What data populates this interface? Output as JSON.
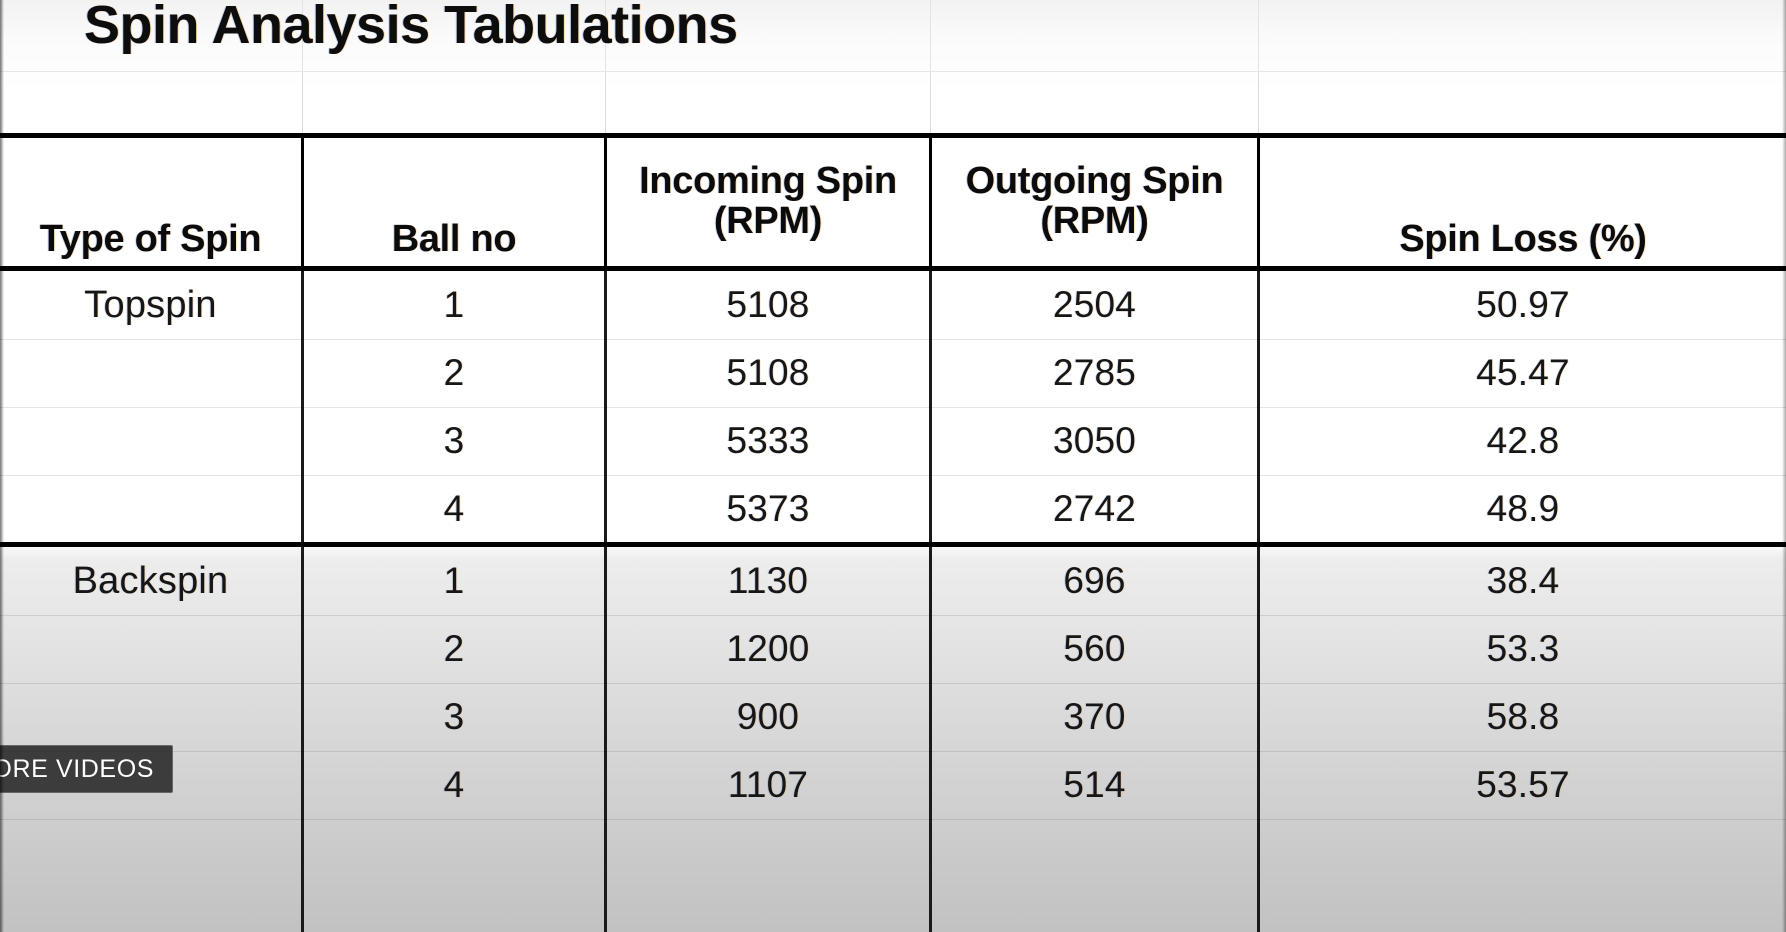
{
  "title": "Spin Analysis Tabulations",
  "table": {
    "headers": [
      "Type of Spin",
      "Ball no",
      "Incoming Spin\n(RPM)",
      "Outgoing Spin\n(RPM)",
      "Spin Loss (%)"
    ],
    "header_lines": {
      "incoming_l1": "Incoming Spin",
      "incoming_l2": "(RPM)",
      "outgoing_l1": "Outgoing Spin",
      "outgoing_l2": "(RPM)"
    },
    "groups": [
      {
        "label": "Topspin",
        "rows": [
          {
            "ball": "1",
            "incoming": "5108",
            "outgoing": "2504",
            "loss": "50.97"
          },
          {
            "ball": "2",
            "incoming": "5108",
            "outgoing": "2785",
            "loss": "45.47"
          },
          {
            "ball": "3",
            "incoming": "5333",
            "outgoing": "3050",
            "loss": "42.8"
          },
          {
            "ball": "4",
            "incoming": "5373",
            "outgoing": "2742",
            "loss": "48.9"
          }
        ]
      },
      {
        "label": "Backspin",
        "rows": [
          {
            "ball": "1",
            "incoming": "1130",
            "outgoing": "696",
            "loss": "38.4"
          },
          {
            "ball": "2",
            "incoming": "1200",
            "outgoing": "560",
            "loss": "53.3"
          },
          {
            "ball": "3",
            "incoming": "900",
            "outgoing": "370",
            "loss": "58.8"
          },
          {
            "ball": "4",
            "incoming": "1107",
            "outgoing": "514",
            "loss": "53.57"
          }
        ]
      }
    ]
  },
  "overlay": {
    "more_videos_label": "MORE VIDEOS"
  },
  "colors": {
    "rule": "#000000",
    "text": "#161616",
    "overlay_bg": "#2f2f2f",
    "overlay_text": "#ffffff"
  },
  "chart_data": {
    "type": "table",
    "title": "Spin Analysis Tabulations",
    "columns": [
      "Type of Spin",
      "Ball no",
      "Incoming Spin (RPM)",
      "Outgoing Spin (RPM)",
      "Spin Loss (%)"
    ],
    "rows": [
      [
        "Topspin",
        "1",
        5108,
        2504,
        50.97
      ],
      [
        "",
        "2",
        5108,
        2785,
        45.47
      ],
      [
        "",
        "3",
        5333,
        3050,
        42.8
      ],
      [
        "",
        "4",
        5373,
        2742,
        48.9
      ],
      [
        "Backspin",
        "1",
        1130,
        696,
        38.4
      ],
      [
        "",
        "2",
        1200,
        560,
        53.3
      ],
      [
        "",
        "3",
        900,
        370,
        58.8
      ],
      [
        "",
        "4",
        1107,
        514,
        53.57
      ]
    ]
  }
}
